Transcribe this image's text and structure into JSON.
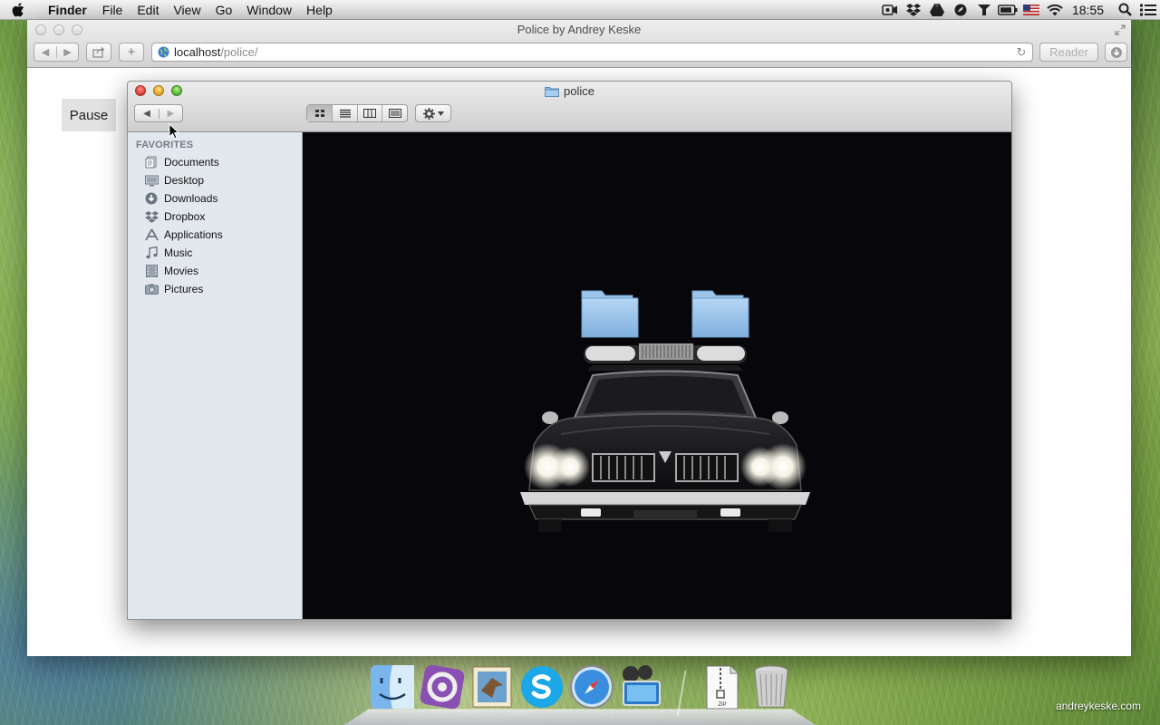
{
  "menubar": {
    "app_name": "Finder",
    "items": [
      "File",
      "Edit",
      "View",
      "Go",
      "Window",
      "Help"
    ],
    "clock": "18:55",
    "status_icons": [
      "facetime-camera-icon",
      "dropbox-icon",
      "google-drive-icon",
      "evernote-icon",
      "alfred-icon",
      "battery-icon",
      "flag-icon",
      "wifi-icon",
      "spotlight-icon",
      "notification-center-icon"
    ]
  },
  "browser": {
    "title": "Police by Andrey Keske",
    "url_host": "localhost",
    "url_path": "/police/",
    "reader_label": "Reader"
  },
  "page": {
    "pause_label": "Pause"
  },
  "finder": {
    "title": "police",
    "sidebar_header": "FAVORITES",
    "sidebar_items": [
      {
        "label": "Documents",
        "icon": "documents-icon"
      },
      {
        "label": "Desktop",
        "icon": "desktop-icon"
      },
      {
        "label": "Downloads",
        "icon": "downloads-icon"
      },
      {
        "label": "Dropbox",
        "icon": "dropbox-icon"
      },
      {
        "label": "Applications",
        "icon": "applications-icon"
      },
      {
        "label": "Music",
        "icon": "music-icon"
      },
      {
        "label": "Movies",
        "icon": "movies-icon"
      },
      {
        "label": "Pictures",
        "icon": "pictures-icon"
      }
    ],
    "active_view": "icon-view"
  },
  "dock": {
    "items": [
      "finder-icon",
      "system-preferences-icon",
      "mail-icon",
      "skype-icon",
      "safari-icon",
      "photo-booth-icon",
      "zip-archive-icon",
      "trash-icon"
    ],
    "zip_label": "ZIP"
  },
  "watermark": "andreykeske.com",
  "colors": {
    "finder_content_bg": "#07070b",
    "sidebar_bg": "#e3e8ee",
    "folder_blue": "#8fbde6"
  }
}
